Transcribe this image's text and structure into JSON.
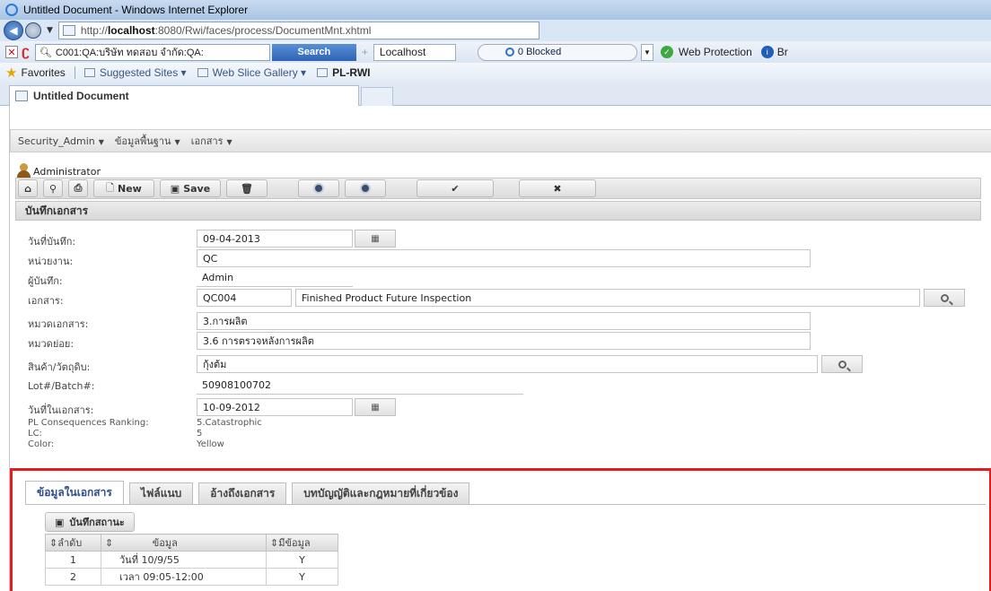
{
  "browser": {
    "title": "Untitled Document - Windows Internet Explorer",
    "url_prefix": "http://",
    "url_host": "localhost",
    "url_rest": ":8080/Rwi/faces/process/DocumentMnt.xhtml",
    "toolbar_search_value": "C001:QA:บริษัท ทดสอบ จำกัด:QA:",
    "search_button": "Search",
    "localhost_field": "Localhost",
    "blocked_label": "0 Blocked",
    "web_protection": "Web Protection",
    "br_label": "Br",
    "favorites_label": "Favorites",
    "fav_items": [
      "Suggested Sites ▾",
      "Web Slice Gallery ▾",
      "PL-RWI"
    ],
    "tab_title": "Untitled Document"
  },
  "menu": {
    "items": [
      "Security_Admin",
      "ข้อมูลพื้นฐาน",
      "เอกสาร"
    ]
  },
  "user": {
    "name": "Administrator"
  },
  "actions": {
    "new_label": "New",
    "save_label": "Save"
  },
  "panel": {
    "title": "บันทึกเอกสาร"
  },
  "form": {
    "record_date_label": "วันที่บันทึก:",
    "record_date": "09-04-2013",
    "unit_label": "หน่วยงาน:",
    "unit": "QC",
    "recorder_label": "ผู้บันทึก:",
    "recorder": "Admin",
    "document_label": "เอกสาร:",
    "document_code": "QC004",
    "document_name": "Finished Product Future Inspection",
    "doc_category_label": "หมวดเอกสาร:",
    "doc_category": "3.การผลิต",
    "sub_category_label": "หมวดย่อย:",
    "sub_category": "3.6 การตรวจหลังการผลิต",
    "product_label": "สินค้า/วัตถุดิบ:",
    "product": "กุ้งต้ม",
    "lot_label": "Lot#/Batch#:",
    "lot": "50908100702",
    "doc_date_label": "วันที่ในเอกสาร:",
    "doc_date": "10-09-2012",
    "ranking_label": "PL Consequences Ranking:",
    "ranking": "5.Catastrophic",
    "lc_label": "LC:",
    "lc": "5",
    "color_label": "Color:",
    "color": "Yellow"
  },
  "detail_tabs": [
    "ข้อมูลในเอกสาร",
    "ไฟล์แนบ",
    "อ้างถึงเอกสาร",
    "บทบัญญัติและกฎหมายที่เกี่ยวข้อง"
  ],
  "save_status_button": "บันทึกสถานะ",
  "table": {
    "headers": [
      "ลำดับ",
      "ข้อมูล",
      "มีข้อมูล"
    ],
    "rows": [
      [
        "1",
        "วันที่ 10/9/55",
        "Y"
      ],
      [
        "2",
        "เวลา 09:05-12:00",
        "Y"
      ]
    ]
  },
  "colors": {
    "highlight": "#e01e1e",
    "accent": "#2e63b5"
  }
}
